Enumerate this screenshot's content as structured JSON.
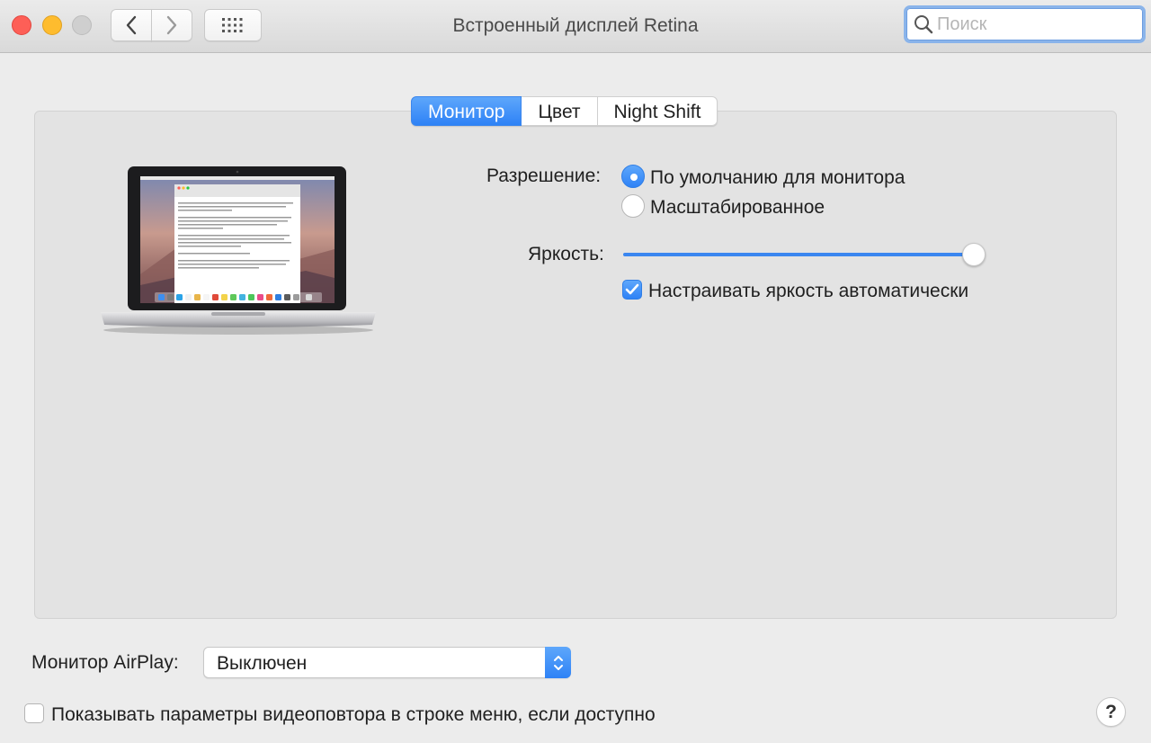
{
  "window": {
    "title": "Встроенный дисплей Retina",
    "traffic_lights": [
      "close",
      "minimize",
      "zoom"
    ]
  },
  "toolbar": {
    "back_icon": "chevron-left-icon",
    "forward_icon": "chevron-right-icon",
    "show_all_icon": "grid-icon"
  },
  "search": {
    "placeholder": "Поиск",
    "value": ""
  },
  "tabs": [
    {
      "label": "Монитор",
      "active": true
    },
    {
      "label": "Цвет",
      "active": false
    },
    {
      "label": "Night Shift",
      "active": false
    }
  ],
  "resolution": {
    "label": "Разрешение:",
    "options": [
      {
        "label": "По умолчанию для монитора",
        "selected": true
      },
      {
        "label": "Масштабированное",
        "selected": false
      }
    ]
  },
  "brightness": {
    "label": "Яркость:",
    "level": 1.0,
    "auto_adjust": {
      "label": "Настраивать яркость автоматически",
      "checked": true
    }
  },
  "airplay": {
    "label": "Монитор AirPlay:",
    "value": "Выключен"
  },
  "mirroring_option": {
    "label": "Показывать параметры видеоповтора в строке меню, если доступно",
    "checked": false
  },
  "help": {
    "label": "?"
  },
  "colors": {
    "accent": "#2e82f6",
    "close": "#fd5f57",
    "minimize": "#febc2e",
    "zoom_disabled": "#cfcfcf"
  }
}
